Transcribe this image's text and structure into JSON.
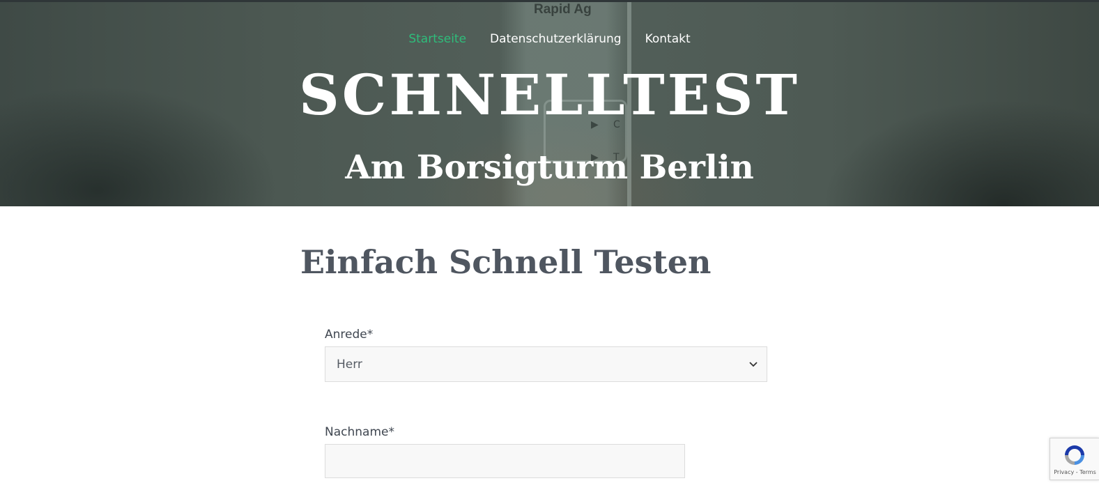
{
  "nav": {
    "items": [
      {
        "label": "Startseite",
        "active": true
      },
      {
        "label": "Datenschutzerklärung",
        "active": false
      },
      {
        "label": "Kontakt",
        "active": false
      }
    ],
    "active_color": "#2ebd7b"
  },
  "hero": {
    "title": "SCHNELLTEST",
    "subtitle": "Am Borsigturm Berlin",
    "image_text": "Rapid Ag",
    "image_markers": [
      "C",
      "T"
    ]
  },
  "main": {
    "section_title": "Einfach Schnell Testen"
  },
  "form": {
    "salutation": {
      "label": "Anrede*",
      "selected": "Herr"
    },
    "lastname": {
      "label": "Nachname*",
      "value": ""
    }
  },
  "recaptcha": {
    "privacy": "Privacy",
    "separator": " - ",
    "terms": "Terms"
  }
}
